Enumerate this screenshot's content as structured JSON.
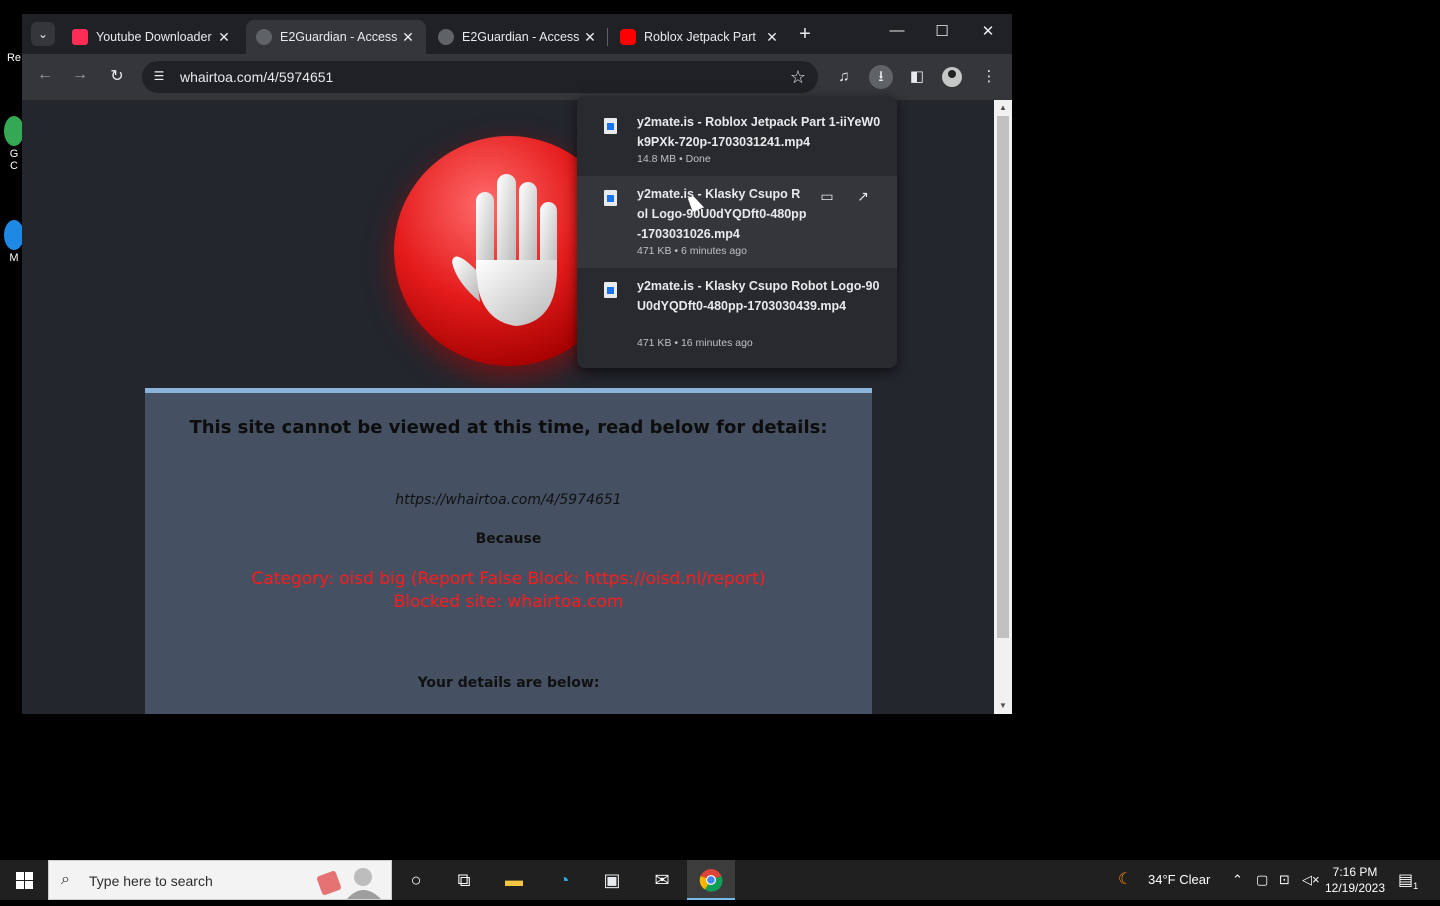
{
  "desktop": {
    "icons": [
      {
        "label": "Re",
        "color": "#cfd8dc"
      },
      {
        "label": "G\nC",
        "color": "#34a853"
      },
      {
        "label": "M",
        "color": "#1e88e5"
      }
    ]
  },
  "browser": {
    "tabs": [
      {
        "title": "Youtube Downloader",
        "favicon_color": "#ff2d55",
        "favicon": "download-icon",
        "active": false
      },
      {
        "title": "E2Guardian - Access",
        "favicon_color": "#5f6368",
        "favicon": "globe-icon",
        "active": true
      },
      {
        "title": "E2Guardian - Access",
        "favicon_color": "#5f6368",
        "favicon": "globe-icon",
        "active": false
      },
      {
        "title": "Roblox Jetpack Part",
        "favicon_color": "#ff0000",
        "favicon": "youtube-icon",
        "active": false
      }
    ],
    "new_tab": "+",
    "window_controls": {
      "minimize": "—",
      "maximize": "☐",
      "close": "✕"
    },
    "url": "whairtoa.com/4/5974651",
    "toolbar_icons": [
      "back-icon",
      "forward-icon",
      "reload-icon",
      "site-info-icon",
      "bookmark-star-icon",
      "media-control-icon",
      "download-icon",
      "side-panel-icon",
      "profile-icon",
      "menu-icon"
    ]
  },
  "downloads": [
    {
      "name": "y2mate.is - Roblox Jetpack Part 1-iiYeW0k9PXk-720p-1703031241.mp4",
      "meta": "14.8 MB • Done"
    },
    {
      "name": "y2mate.is - Klasky Csupo Rol Logo-90U0dYQDft0-480pp-1703031026.mp4",
      "meta": "471 KB • 6 minutes ago"
    },
    {
      "name": "y2mate.is - Klasky Csupo Robot Logo-90U0dYQDft0-480pp-1703030439.mp4",
      "meta": "471 KB • 16 minutes ago"
    }
  ],
  "blocked_page": {
    "heading": "This site cannot be viewed at this time, read below for details:",
    "url": "https://whairtoa.com/4/5974651",
    "because": "Because",
    "category": "Category: oisd big (Report False Block: https://oisd.nl/report)",
    "blocked_site": "Blocked site: whairtoa.com",
    "details": "Your details are below:"
  },
  "taskbar": {
    "search_placeholder": "Type here to search",
    "weather": "34°F  Clear",
    "time": "7:16 PM",
    "date": "12/19/2023",
    "notification_count": "1",
    "accent_color": "#76b9ed"
  }
}
